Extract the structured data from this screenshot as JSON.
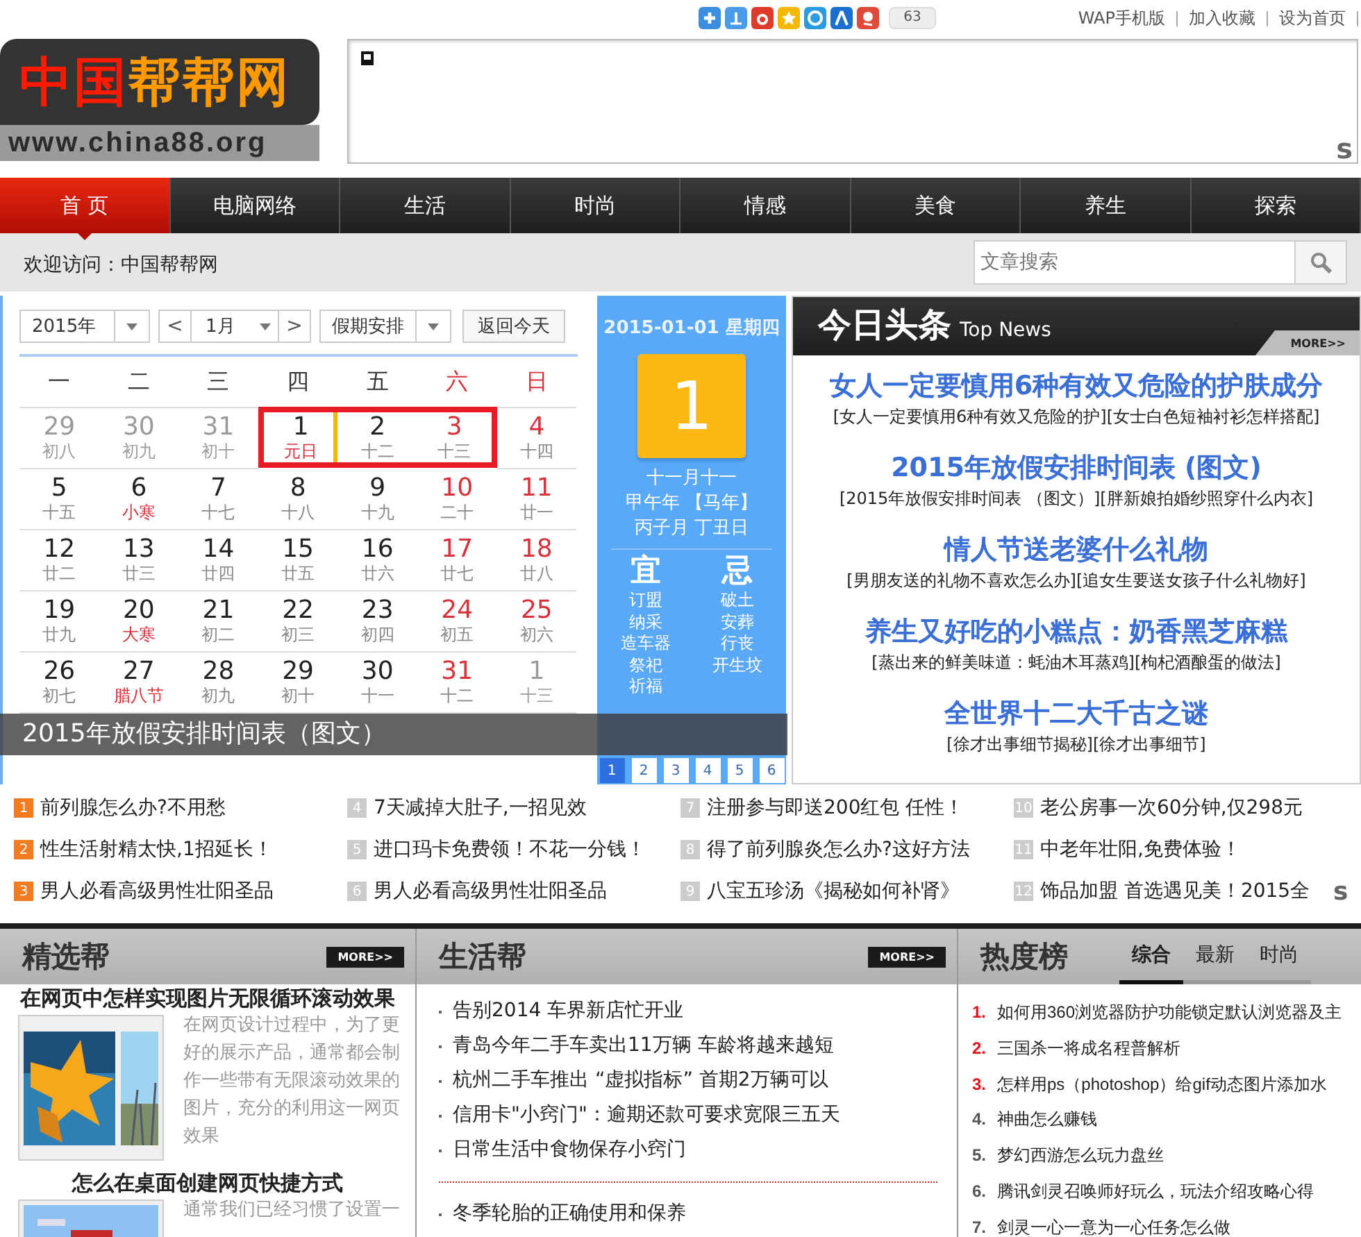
{
  "header": {
    "share_count": "63",
    "links": [
      "WAP手机版",
      "加入收藏",
      "设为首页"
    ],
    "logo_parts": [
      "中国",
      "帮帮网"
    ],
    "logo_url": "www.china88.org",
    "ad_mark": "s"
  },
  "nav": [
    {
      "label": "首 页",
      "selected": true
    },
    {
      "label": "电脑网络",
      "selected": false
    },
    {
      "label": "生活",
      "selected": false
    },
    {
      "label": "时尚",
      "selected": false
    },
    {
      "label": "情感",
      "selected": false
    },
    {
      "label": "美食",
      "selected": false
    },
    {
      "label": "养生",
      "selected": false
    },
    {
      "label": "探索",
      "selected": false
    }
  ],
  "welcome": "欢迎访问：中国帮帮网",
  "search": {
    "placeholder": "文章搜索"
  },
  "calendar": {
    "year": "2015年",
    "prev": "<",
    "month": "1月",
    "next": ">",
    "mode": "假期安排",
    "today_button": "返回今天",
    "weekdays": [
      "一",
      "二",
      "三",
      "四",
      "五",
      "六",
      "日"
    ],
    "weeks": [
      [
        {
          "day": "29",
          "lunar": "初八",
          "other_month": true,
          "festival": false,
          "holiday": false,
          "selected": false
        },
        {
          "day": "30",
          "lunar": "初九",
          "other_month": true,
          "festival": false,
          "holiday": false,
          "selected": false
        },
        {
          "day": "31",
          "lunar": "初十",
          "other_month": true,
          "festival": false,
          "holiday": false,
          "selected": false
        },
        {
          "day": "1",
          "lunar": "元日",
          "other_month": false,
          "festival": true,
          "holiday": true,
          "selected": true
        },
        {
          "day": "2",
          "lunar": "十二",
          "other_month": false,
          "festival": false,
          "holiday": true,
          "selected": false
        },
        {
          "day": "3",
          "lunar": "十三",
          "other_month": false,
          "festival": false,
          "holiday": true,
          "selected": false
        },
        {
          "day": "4",
          "lunar": "十四",
          "other_month": false,
          "festival": false,
          "holiday": false,
          "selected": false
        }
      ],
      [
        {
          "day": "5",
          "lunar": "十五",
          "other_month": false,
          "festival": false,
          "holiday": false,
          "selected": false
        },
        {
          "day": "6",
          "lunar": "小寒",
          "other_month": false,
          "festival": true,
          "holiday": false,
          "selected": false
        },
        {
          "day": "7",
          "lunar": "十七",
          "other_month": false,
          "festival": false,
          "holiday": false,
          "selected": false
        },
        {
          "day": "8",
          "lunar": "十八",
          "other_month": false,
          "festival": false,
          "holiday": false,
          "selected": false
        },
        {
          "day": "9",
          "lunar": "十九",
          "other_month": false,
          "festival": false,
          "holiday": false,
          "selected": false
        },
        {
          "day": "10",
          "lunar": "二十",
          "other_month": false,
          "festival": false,
          "holiday": false,
          "selected": false
        },
        {
          "day": "11",
          "lunar": "廿一",
          "other_month": false,
          "festival": false,
          "holiday": false,
          "selected": false
        }
      ],
      [
        {
          "day": "12",
          "lunar": "廿二",
          "other_month": false,
          "festival": false,
          "holiday": false,
          "selected": false
        },
        {
          "day": "13",
          "lunar": "廿三",
          "other_month": false,
          "festival": false,
          "holiday": false,
          "selected": false
        },
        {
          "day": "14",
          "lunar": "廿四",
          "other_month": false,
          "festival": false,
          "holiday": false,
          "selected": false
        },
        {
          "day": "15",
          "lunar": "廿五",
          "other_month": false,
          "festival": false,
          "holiday": false,
          "selected": false
        },
        {
          "day": "16",
          "lunar": "廿六",
          "other_month": false,
          "festival": false,
          "holiday": false,
          "selected": false
        },
        {
          "day": "17",
          "lunar": "廿七",
          "other_month": false,
          "festival": false,
          "holiday": false,
          "selected": false
        },
        {
          "day": "18",
          "lunar": "廿八",
          "other_month": false,
          "festival": false,
          "holiday": false,
          "selected": false
        }
      ],
      [
        {
          "day": "19",
          "lunar": "廿九",
          "other_month": false,
          "festival": false,
          "holiday": false,
          "selected": false
        },
        {
          "day": "20",
          "lunar": "大寒",
          "other_month": false,
          "festival": true,
          "holiday": false,
          "selected": false
        },
        {
          "day": "21",
          "lunar": "初二",
          "other_month": false,
          "festival": false,
          "holiday": false,
          "selected": false
        },
        {
          "day": "22",
          "lunar": "初三",
          "other_month": false,
          "festival": false,
          "holiday": false,
          "selected": false
        },
        {
          "day": "23",
          "lunar": "初四",
          "other_month": false,
          "festival": false,
          "holiday": false,
          "selected": false
        },
        {
          "day": "24",
          "lunar": "初五",
          "other_month": false,
          "festival": false,
          "holiday": false,
          "selected": false
        },
        {
          "day": "25",
          "lunar": "初六",
          "other_month": false,
          "festival": false,
          "holiday": false,
          "selected": false
        }
      ],
      [
        {
          "day": "26",
          "lunar": "初七",
          "other_month": false,
          "festival": false,
          "holiday": false,
          "selected": false
        },
        {
          "day": "27",
          "lunar": "腊八节",
          "other_month": false,
          "festival": true,
          "holiday": false,
          "selected": false
        },
        {
          "day": "28",
          "lunar": "初九",
          "other_month": false,
          "festival": false,
          "holiday": false,
          "selected": false
        },
        {
          "day": "29",
          "lunar": "初十",
          "other_month": false,
          "festival": false,
          "holiday": false,
          "selected": false
        },
        {
          "day": "30",
          "lunar": "十一",
          "other_month": false,
          "festival": false,
          "holiday": false,
          "selected": false
        },
        {
          "day": "31",
          "lunar": "十二",
          "other_month": false,
          "festival": false,
          "holiday": false,
          "selected": false
        },
        {
          "day": "1",
          "lunar": "十三",
          "other_month": true,
          "festival": false,
          "holiday": false,
          "selected": false
        }
      ]
    ]
  },
  "almanac": {
    "date": "2015-01-01 星期四",
    "day": "1",
    "lunar_lines": [
      "十一月十一",
      "甲午年 【马年】",
      "丙子月 丁丑日"
    ],
    "good_label": "宜",
    "bad_label": "忌",
    "good": [
      "订盟",
      "纳采",
      "造车器",
      "祭祀",
      "祈福"
    ],
    "bad": [
      "破土",
      "安葬",
      "行丧",
      "开生坟"
    ]
  },
  "slides": {
    "caption": "2015年放假安排时间表（图文）",
    "pages": [
      {
        "label": "1",
        "selected": true
      },
      {
        "label": "2",
        "selected": false
      },
      {
        "label": "3",
        "selected": false
      },
      {
        "label": "4",
        "selected": false
      },
      {
        "label": "5",
        "selected": false
      },
      {
        "label": "6",
        "selected": false
      }
    ]
  },
  "top_news": {
    "title": "今日头条",
    "subtitle": "Top News",
    "more": "MORE>>",
    "items": [
      {
        "title": "女人一定要慎用6种有效又危险的护肤成分",
        "links": [
          "[女人一定要慎用6种有效又危险的护]",
          "[女士白色短袖衬衫怎样搭配]"
        ]
      },
      {
        "title": "2015年放假安排时间表 (图文)",
        "links": [
          "[2015年放假安排时间表 （图文）]",
          "[胖新娘拍婚纱照穿什么内衣]"
        ]
      },
      {
        "title": "情人节送老婆什么礼物",
        "links": [
          "[男朋友送的礼物不喜欢怎么办]",
          "[追女生要送女孩子什么礼物好]"
        ]
      },
      {
        "title": "养生又好吃的小糕点：奶香黑芝麻糕",
        "links": [
          "[蒸出来的鲜美味道：蚝油木耳蒸鸡]",
          "[枸杞酒酿蛋的做法]"
        ]
      },
      {
        "title": "全世界十二大千古之谜",
        "links": [
          "[徐才出事细节揭秘]",
          "[徐才出事细节]"
        ]
      }
    ]
  },
  "ads": {
    "mark": "s",
    "items": [
      {
        "number": "1",
        "text": "前列腺怎么办?不用愁",
        "hot": true
      },
      {
        "number": "2",
        "text": "性生活射精太快,1招延长！",
        "hot": true
      },
      {
        "number": "3",
        "text": "男人必看高级男性壮阳圣品",
        "hot": true
      },
      {
        "number": "4",
        "text": "7天减掉大肚子,一招见效",
        "hot": false
      },
      {
        "number": "5",
        "text": "进口玛卡免费领！不花一分钱！",
        "hot": false
      },
      {
        "number": "6",
        "text": "男人必看高级男性壮阳圣品",
        "hot": false
      },
      {
        "number": "7",
        "text": "注册参与即送200红包 任性！",
        "hot": false
      },
      {
        "number": "8",
        "text": "得了前列腺炎怎么办?这好方法",
        "hot": false
      },
      {
        "number": "9",
        "text": "八宝五珍汤《揭秘如何补肾》",
        "hot": false
      },
      {
        "number": "10",
        "text": "老公房事一次60分钟,仅298元",
        "hot": false
      },
      {
        "number": "11",
        "text": "中老年壮阳,免费体验！",
        "hot": false
      },
      {
        "number": "12",
        "text": "饰品加盟 首选遇见美！2015全",
        "hot": false
      }
    ]
  },
  "featured": {
    "title": "精选帮",
    "more": "MORE>>",
    "articles": [
      {
        "title": "在网页中怎样实现图片无限循环滚动效果",
        "summary": "在网页设计过程中，为了更好的展示产品，通常都会制作一些带有无限滚动效果的图片，充分的利用这一网页效果"
      },
      {
        "title": "怎么在桌面创建网页快捷方式",
        "summary": "通常我们已经习惯了设置一"
      }
    ]
  },
  "life": {
    "title": "生活帮",
    "more": "MORE>>",
    "groups": [
      [
        "告别2014 车界新店忙开业",
        "青岛今年二手车卖出11万辆 车龄将越来越短",
        "杭州二手车推出 “虚拟指标” 首期2万辆可以",
        "信用卡\"小窍门\"：逾期还款可要求宽限三五天",
        "日常生活中食物保存小窍门"
      ],
      [
        "冬季轮胎的正确使用和保养"
      ]
    ]
  },
  "ranking": {
    "title": "热度榜",
    "tabs": [
      {
        "label": "综合",
        "selected": true
      },
      {
        "label": "最新",
        "selected": false
      },
      {
        "label": "时尚",
        "selected": false
      }
    ],
    "items": [
      {
        "number": "1.",
        "text": "如何用360浏览器防护功能锁定默认浏览器及主",
        "hot": true
      },
      {
        "number": "2.",
        "text": "三国杀一将成名程普解析",
        "hot": true
      },
      {
        "number": "3.",
        "text": "怎样用ps（photoshop）给gif动态图片添加水",
        "hot": true
      },
      {
        "number": "4.",
        "text": "神曲怎么赚钱",
        "hot": false
      },
      {
        "number": "5.",
        "text": "梦幻西游怎么玩力盘丝",
        "hot": false
      },
      {
        "number": "6.",
        "text": "腾讯剑灵召唤师好玩么，玩法介绍攻略心得",
        "hot": false
      },
      {
        "number": "7.",
        "text": "剑灵一心一意为一心任务怎么做",
        "hot": false
      }
    ]
  }
}
